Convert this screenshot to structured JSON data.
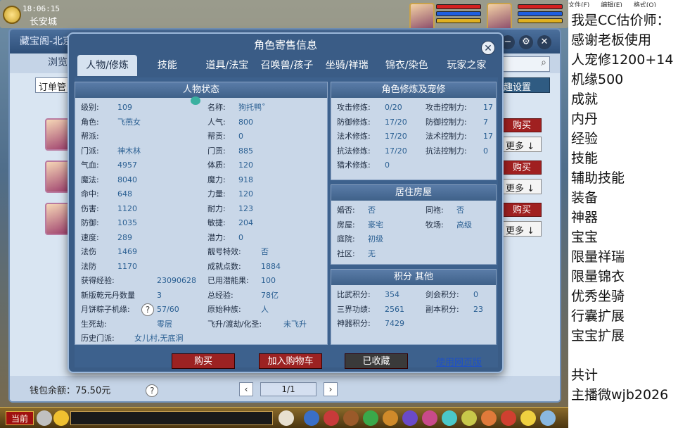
{
  "hud": {
    "time": "18:06:15",
    "location": "长安城"
  },
  "shop": {
    "title": "藏宝阁-北京",
    "nav_label": "浏览",
    "order_label": "订单管",
    "interest_label": "兴趣设置",
    "buy_label": "购买",
    "more_label": "更多",
    "wallet": "钱包余额：75.50元",
    "help": "?",
    "page": "1/1",
    "prev": "‹",
    "next": "›"
  },
  "dialog": {
    "title": "角色寄售信息",
    "tabs": [
      "人物/修炼",
      "技能",
      "道具/法宝",
      "召唤兽/孩子",
      "坐骑/祥瑞",
      "锦衣/染色",
      "玩家之家"
    ],
    "active_tab": 0,
    "status_header": "人物状态",
    "status_left": [
      {
        "k": "级别:",
        "v": "109"
      },
      {
        "k": "角色:",
        "v": "飞燕女"
      },
      {
        "k": "帮派:",
        "v": ""
      },
      {
        "k": "门派:",
        "v": "神木林"
      },
      {
        "k": "气血:",
        "v": "4957"
      },
      {
        "k": "魔法:",
        "v": "8040"
      },
      {
        "k": "命中:",
        "v": "648"
      },
      {
        "k": "伤害:",
        "v": "1120"
      },
      {
        "k": "防御:",
        "v": "1035"
      },
      {
        "k": "速度:",
        "v": "289"
      },
      {
        "k": "法伤",
        "v": "1469"
      },
      {
        "k": "法防",
        "v": "1170"
      },
      {
        "k": "获得经验:",
        "v": "23090628"
      },
      {
        "k": "新版乾元丹数量",
        "v": "3"
      },
      {
        "k": "月饼粽子机缘:",
        "v": "57/60"
      },
      {
        "k": "生死劫:",
        "v": "零层"
      },
      {
        "k": "历史门派:",
        "v": "女儿村,无底洞"
      }
    ],
    "status_right": [
      {
        "k": "名称:",
        "v": "狗托鸭˚"
      },
      {
        "k": "人气:",
        "v": "800"
      },
      {
        "k": "帮贡:",
        "v": "0"
      },
      {
        "k": "门贡:",
        "v": "885"
      },
      {
        "k": "体质:",
        "v": "120"
      },
      {
        "k": "魔力:",
        "v": "918"
      },
      {
        "k": "力量:",
        "v": "120"
      },
      {
        "k": "耐力:",
        "v": "123"
      },
      {
        "k": "敏捷:",
        "v": "204"
      },
      {
        "k": "潜力:",
        "v": "0"
      },
      {
        "k": "靓号特效:",
        "v": "否"
      },
      {
        "k": "成就点数:",
        "v": "1884"
      },
      {
        "k": "已用潜能果:",
        "v": "100"
      },
      {
        "k": "总经验:",
        "v": "78亿"
      },
      {
        "k": "原始种族:",
        "v": "人"
      },
      {
        "k": "飞升/渡劫/化圣:",
        "v": "未飞升"
      }
    ],
    "cult_header": "角色修炼及宠修",
    "cult_left": [
      {
        "k": "攻击修炼:",
        "v": "0/20"
      },
      {
        "k": "防御修炼:",
        "v": "17/20"
      },
      {
        "k": "法术修炼:",
        "v": "17/20"
      },
      {
        "k": "抗法修炼:",
        "v": "17/20"
      },
      {
        "k": "猎术修炼:",
        "v": "0"
      }
    ],
    "cult_right": [
      {
        "k": "攻击控制力:",
        "v": "17"
      },
      {
        "k": "防御控制力:",
        "v": "7"
      },
      {
        "k": "法术控制力:",
        "v": "17"
      },
      {
        "k": "抗法控制力:",
        "v": "0"
      }
    ],
    "house_header": "居住房屋",
    "house_left": [
      {
        "k": "婚否:",
        "v": "否"
      },
      {
        "k": "房屋:",
        "v": "豪宅"
      },
      {
        "k": "庭院:",
        "v": "初级"
      },
      {
        "k": "社区:",
        "v": "无"
      }
    ],
    "house_right": [
      {
        "k": "同袍:",
        "v": "否"
      },
      {
        "k": "牧场:",
        "v": "高级"
      }
    ],
    "score_header": "积分 其他",
    "score_left": [
      {
        "k": "比武积分:",
        "v": "354"
      },
      {
        "k": "三界功绩:",
        "v": "2561"
      },
      {
        "k": "神器积分:",
        "v": "7429"
      }
    ],
    "score_right": [
      {
        "k": "剑会积分:",
        "v": "0"
      },
      {
        "k": "副本积分:",
        "v": "23"
      }
    ],
    "buy_label": "购买",
    "cart_label": "加入购物车",
    "fav_label": "已收藏",
    "web_label": "使用网页版"
  },
  "gamebar": {
    "current_label": "当前"
  },
  "overlay": {
    "menu": [
      "文件(F)",
      "编辑(E)",
      "格式(O)"
    ],
    "lines": [
      "我是CC估价师：",
      "感谢老板使用",
      "人宠修1200+14",
      "机缘500",
      "成就",
      "内丹",
      "经验",
      "技能",
      "辅助技能",
      "装备",
      "神器",
      "宝宝",
      "限量祥瑞",
      "限量锦衣",
      "优秀坐骑",
      "行囊扩展",
      "宝宝扩展",
      "",
      "共计",
      "主播微wjb2026"
    ]
  }
}
